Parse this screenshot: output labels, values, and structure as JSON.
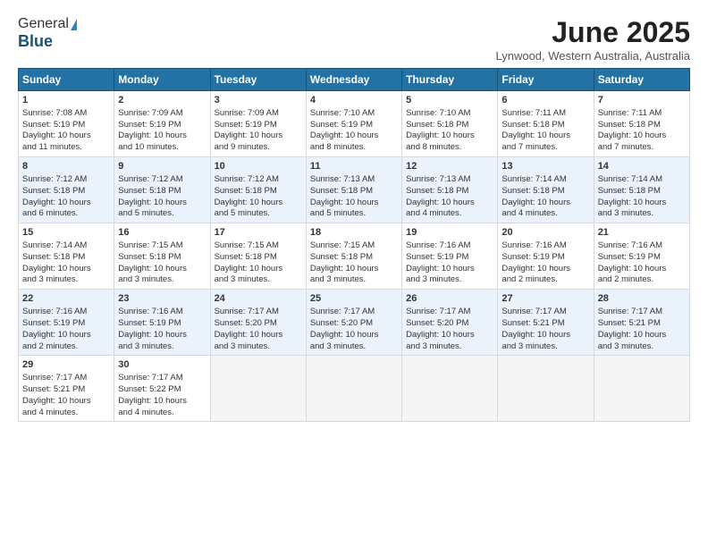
{
  "header": {
    "logo_general": "General",
    "logo_blue": "Blue",
    "main_title": "June 2025",
    "subtitle": "Lynwood, Western Australia, Australia"
  },
  "columns": [
    "Sunday",
    "Monday",
    "Tuesday",
    "Wednesday",
    "Thursday",
    "Friday",
    "Saturday"
  ],
  "weeks": [
    [
      {
        "day": "1",
        "lines": [
          "Sunrise: 7:08 AM",
          "Sunset: 5:19 PM",
          "Daylight: 10 hours",
          "and 11 minutes."
        ]
      },
      {
        "day": "2",
        "lines": [
          "Sunrise: 7:09 AM",
          "Sunset: 5:19 PM",
          "Daylight: 10 hours",
          "and 10 minutes."
        ]
      },
      {
        "day": "3",
        "lines": [
          "Sunrise: 7:09 AM",
          "Sunset: 5:19 PM",
          "Daylight: 10 hours",
          "and 9 minutes."
        ]
      },
      {
        "day": "4",
        "lines": [
          "Sunrise: 7:10 AM",
          "Sunset: 5:19 PM",
          "Daylight: 10 hours",
          "and 8 minutes."
        ]
      },
      {
        "day": "5",
        "lines": [
          "Sunrise: 7:10 AM",
          "Sunset: 5:18 PM",
          "Daylight: 10 hours",
          "and 8 minutes."
        ]
      },
      {
        "day": "6",
        "lines": [
          "Sunrise: 7:11 AM",
          "Sunset: 5:18 PM",
          "Daylight: 10 hours",
          "and 7 minutes."
        ]
      },
      {
        "day": "7",
        "lines": [
          "Sunrise: 7:11 AM",
          "Sunset: 5:18 PM",
          "Daylight: 10 hours",
          "and 7 minutes."
        ]
      }
    ],
    [
      {
        "day": "8",
        "lines": [
          "Sunrise: 7:12 AM",
          "Sunset: 5:18 PM",
          "Daylight: 10 hours",
          "and 6 minutes."
        ]
      },
      {
        "day": "9",
        "lines": [
          "Sunrise: 7:12 AM",
          "Sunset: 5:18 PM",
          "Daylight: 10 hours",
          "and 5 minutes."
        ]
      },
      {
        "day": "10",
        "lines": [
          "Sunrise: 7:12 AM",
          "Sunset: 5:18 PM",
          "Daylight: 10 hours",
          "and 5 minutes."
        ]
      },
      {
        "day": "11",
        "lines": [
          "Sunrise: 7:13 AM",
          "Sunset: 5:18 PM",
          "Daylight: 10 hours",
          "and 5 minutes."
        ]
      },
      {
        "day": "12",
        "lines": [
          "Sunrise: 7:13 AM",
          "Sunset: 5:18 PM",
          "Daylight: 10 hours",
          "and 4 minutes."
        ]
      },
      {
        "day": "13",
        "lines": [
          "Sunrise: 7:14 AM",
          "Sunset: 5:18 PM",
          "Daylight: 10 hours",
          "and 4 minutes."
        ]
      },
      {
        "day": "14",
        "lines": [
          "Sunrise: 7:14 AM",
          "Sunset: 5:18 PM",
          "Daylight: 10 hours",
          "and 3 minutes."
        ]
      }
    ],
    [
      {
        "day": "15",
        "lines": [
          "Sunrise: 7:14 AM",
          "Sunset: 5:18 PM",
          "Daylight: 10 hours",
          "and 3 minutes."
        ]
      },
      {
        "day": "16",
        "lines": [
          "Sunrise: 7:15 AM",
          "Sunset: 5:18 PM",
          "Daylight: 10 hours",
          "and 3 minutes."
        ]
      },
      {
        "day": "17",
        "lines": [
          "Sunrise: 7:15 AM",
          "Sunset: 5:18 PM",
          "Daylight: 10 hours",
          "and 3 minutes."
        ]
      },
      {
        "day": "18",
        "lines": [
          "Sunrise: 7:15 AM",
          "Sunset: 5:18 PM",
          "Daylight: 10 hours",
          "and 3 minutes."
        ]
      },
      {
        "day": "19",
        "lines": [
          "Sunrise: 7:16 AM",
          "Sunset: 5:19 PM",
          "Daylight: 10 hours",
          "and 3 minutes."
        ]
      },
      {
        "day": "20",
        "lines": [
          "Sunrise: 7:16 AM",
          "Sunset: 5:19 PM",
          "Daylight: 10 hours",
          "and 2 minutes."
        ]
      },
      {
        "day": "21",
        "lines": [
          "Sunrise: 7:16 AM",
          "Sunset: 5:19 PM",
          "Daylight: 10 hours",
          "and 2 minutes."
        ]
      }
    ],
    [
      {
        "day": "22",
        "lines": [
          "Sunrise: 7:16 AM",
          "Sunset: 5:19 PM",
          "Daylight: 10 hours",
          "and 2 minutes."
        ]
      },
      {
        "day": "23",
        "lines": [
          "Sunrise: 7:16 AM",
          "Sunset: 5:19 PM",
          "Daylight: 10 hours",
          "and 3 minutes."
        ]
      },
      {
        "day": "24",
        "lines": [
          "Sunrise: 7:17 AM",
          "Sunset: 5:20 PM",
          "Daylight: 10 hours",
          "and 3 minutes."
        ]
      },
      {
        "day": "25",
        "lines": [
          "Sunrise: 7:17 AM",
          "Sunset: 5:20 PM",
          "Daylight: 10 hours",
          "and 3 minutes."
        ]
      },
      {
        "day": "26",
        "lines": [
          "Sunrise: 7:17 AM",
          "Sunset: 5:20 PM",
          "Daylight: 10 hours",
          "and 3 minutes."
        ]
      },
      {
        "day": "27",
        "lines": [
          "Sunrise: 7:17 AM",
          "Sunset: 5:21 PM",
          "Daylight: 10 hours",
          "and 3 minutes."
        ]
      },
      {
        "day": "28",
        "lines": [
          "Sunrise: 7:17 AM",
          "Sunset: 5:21 PM",
          "Daylight: 10 hours",
          "and 3 minutes."
        ]
      }
    ],
    [
      {
        "day": "29",
        "lines": [
          "Sunrise: 7:17 AM",
          "Sunset: 5:21 PM",
          "Daylight: 10 hours",
          "and 4 minutes."
        ]
      },
      {
        "day": "30",
        "lines": [
          "Sunrise: 7:17 AM",
          "Sunset: 5:22 PM",
          "Daylight: 10 hours",
          "and 4 minutes."
        ]
      },
      {
        "day": "",
        "lines": []
      },
      {
        "day": "",
        "lines": []
      },
      {
        "day": "",
        "lines": []
      },
      {
        "day": "",
        "lines": []
      },
      {
        "day": "",
        "lines": []
      }
    ]
  ]
}
